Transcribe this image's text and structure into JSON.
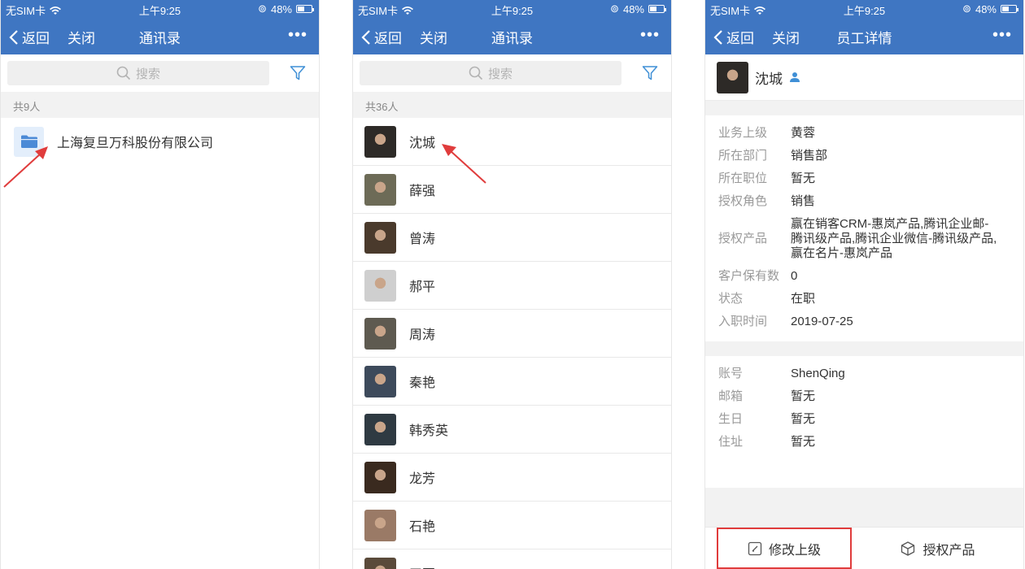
{
  "status": {
    "carrier": "无SIM卡",
    "time": "上午9:25",
    "battery": "48%",
    "battery_level": 0.48
  },
  "nav": {
    "back": "返回",
    "close": "关闭",
    "more": "•••"
  },
  "panel1": {
    "title": "通讯录",
    "search_placeholder": "搜索",
    "count": "共9人",
    "org_name": "上海复旦万科股份有限公司"
  },
  "panel2": {
    "title": "通讯录",
    "search_placeholder": "搜索",
    "count": "共36人",
    "contacts": [
      {
        "name": "沈城",
        "color": "#2d2a27"
      },
      {
        "name": "薛强",
        "color": "#6d6b57"
      },
      {
        "name": "曾涛",
        "color": "#4a3a2c"
      },
      {
        "name": "郝平",
        "color": "#cfcfcf"
      },
      {
        "name": "周涛",
        "color": "#5e5a50"
      },
      {
        "name": "秦艳",
        "color": "#3d4a5b"
      },
      {
        "name": "韩秀英",
        "color": "#2f3a42"
      },
      {
        "name": "龙芳",
        "color": "#3a2a1f"
      },
      {
        "name": "石艳",
        "color": "#9a7a66"
      },
      {
        "name": "王军",
        "color": "#5a4a3a"
      }
    ]
  },
  "panel3": {
    "title": "员工详情",
    "name": "沈城",
    "avatar_color": "#2d2a27",
    "section1": [
      {
        "k": "业务上级",
        "v": "黄蓉"
      },
      {
        "k": "所在部门",
        "v": "销售部"
      },
      {
        "k": "所在职位",
        "v": "暂无"
      },
      {
        "k": "授权角色",
        "v": "销售"
      },
      {
        "k": "授权产品",
        "v": "赢在销客CRM-惠岚产品,腾讯企业邮-腾讯级产品,腾讯企业微信-腾讯级产品,赢在名片-惠岚产品"
      },
      {
        "k": "客户保有数",
        "v": "0"
      },
      {
        "k": "状态",
        "v": "在职"
      },
      {
        "k": "入职时间",
        "v": "2019-07-25"
      }
    ],
    "section2": [
      {
        "k": "账号",
        "v": "ShenQing"
      },
      {
        "k": "邮箱",
        "v": "暂无"
      },
      {
        "k": "生日",
        "v": "暂无"
      },
      {
        "k": "住址",
        "v": "暂无"
      }
    ],
    "btn_modify": "修改上级",
    "btn_products": "授权产品"
  },
  "colors": {
    "brand": "#3f76c2",
    "annotation": "#e03c3c"
  }
}
